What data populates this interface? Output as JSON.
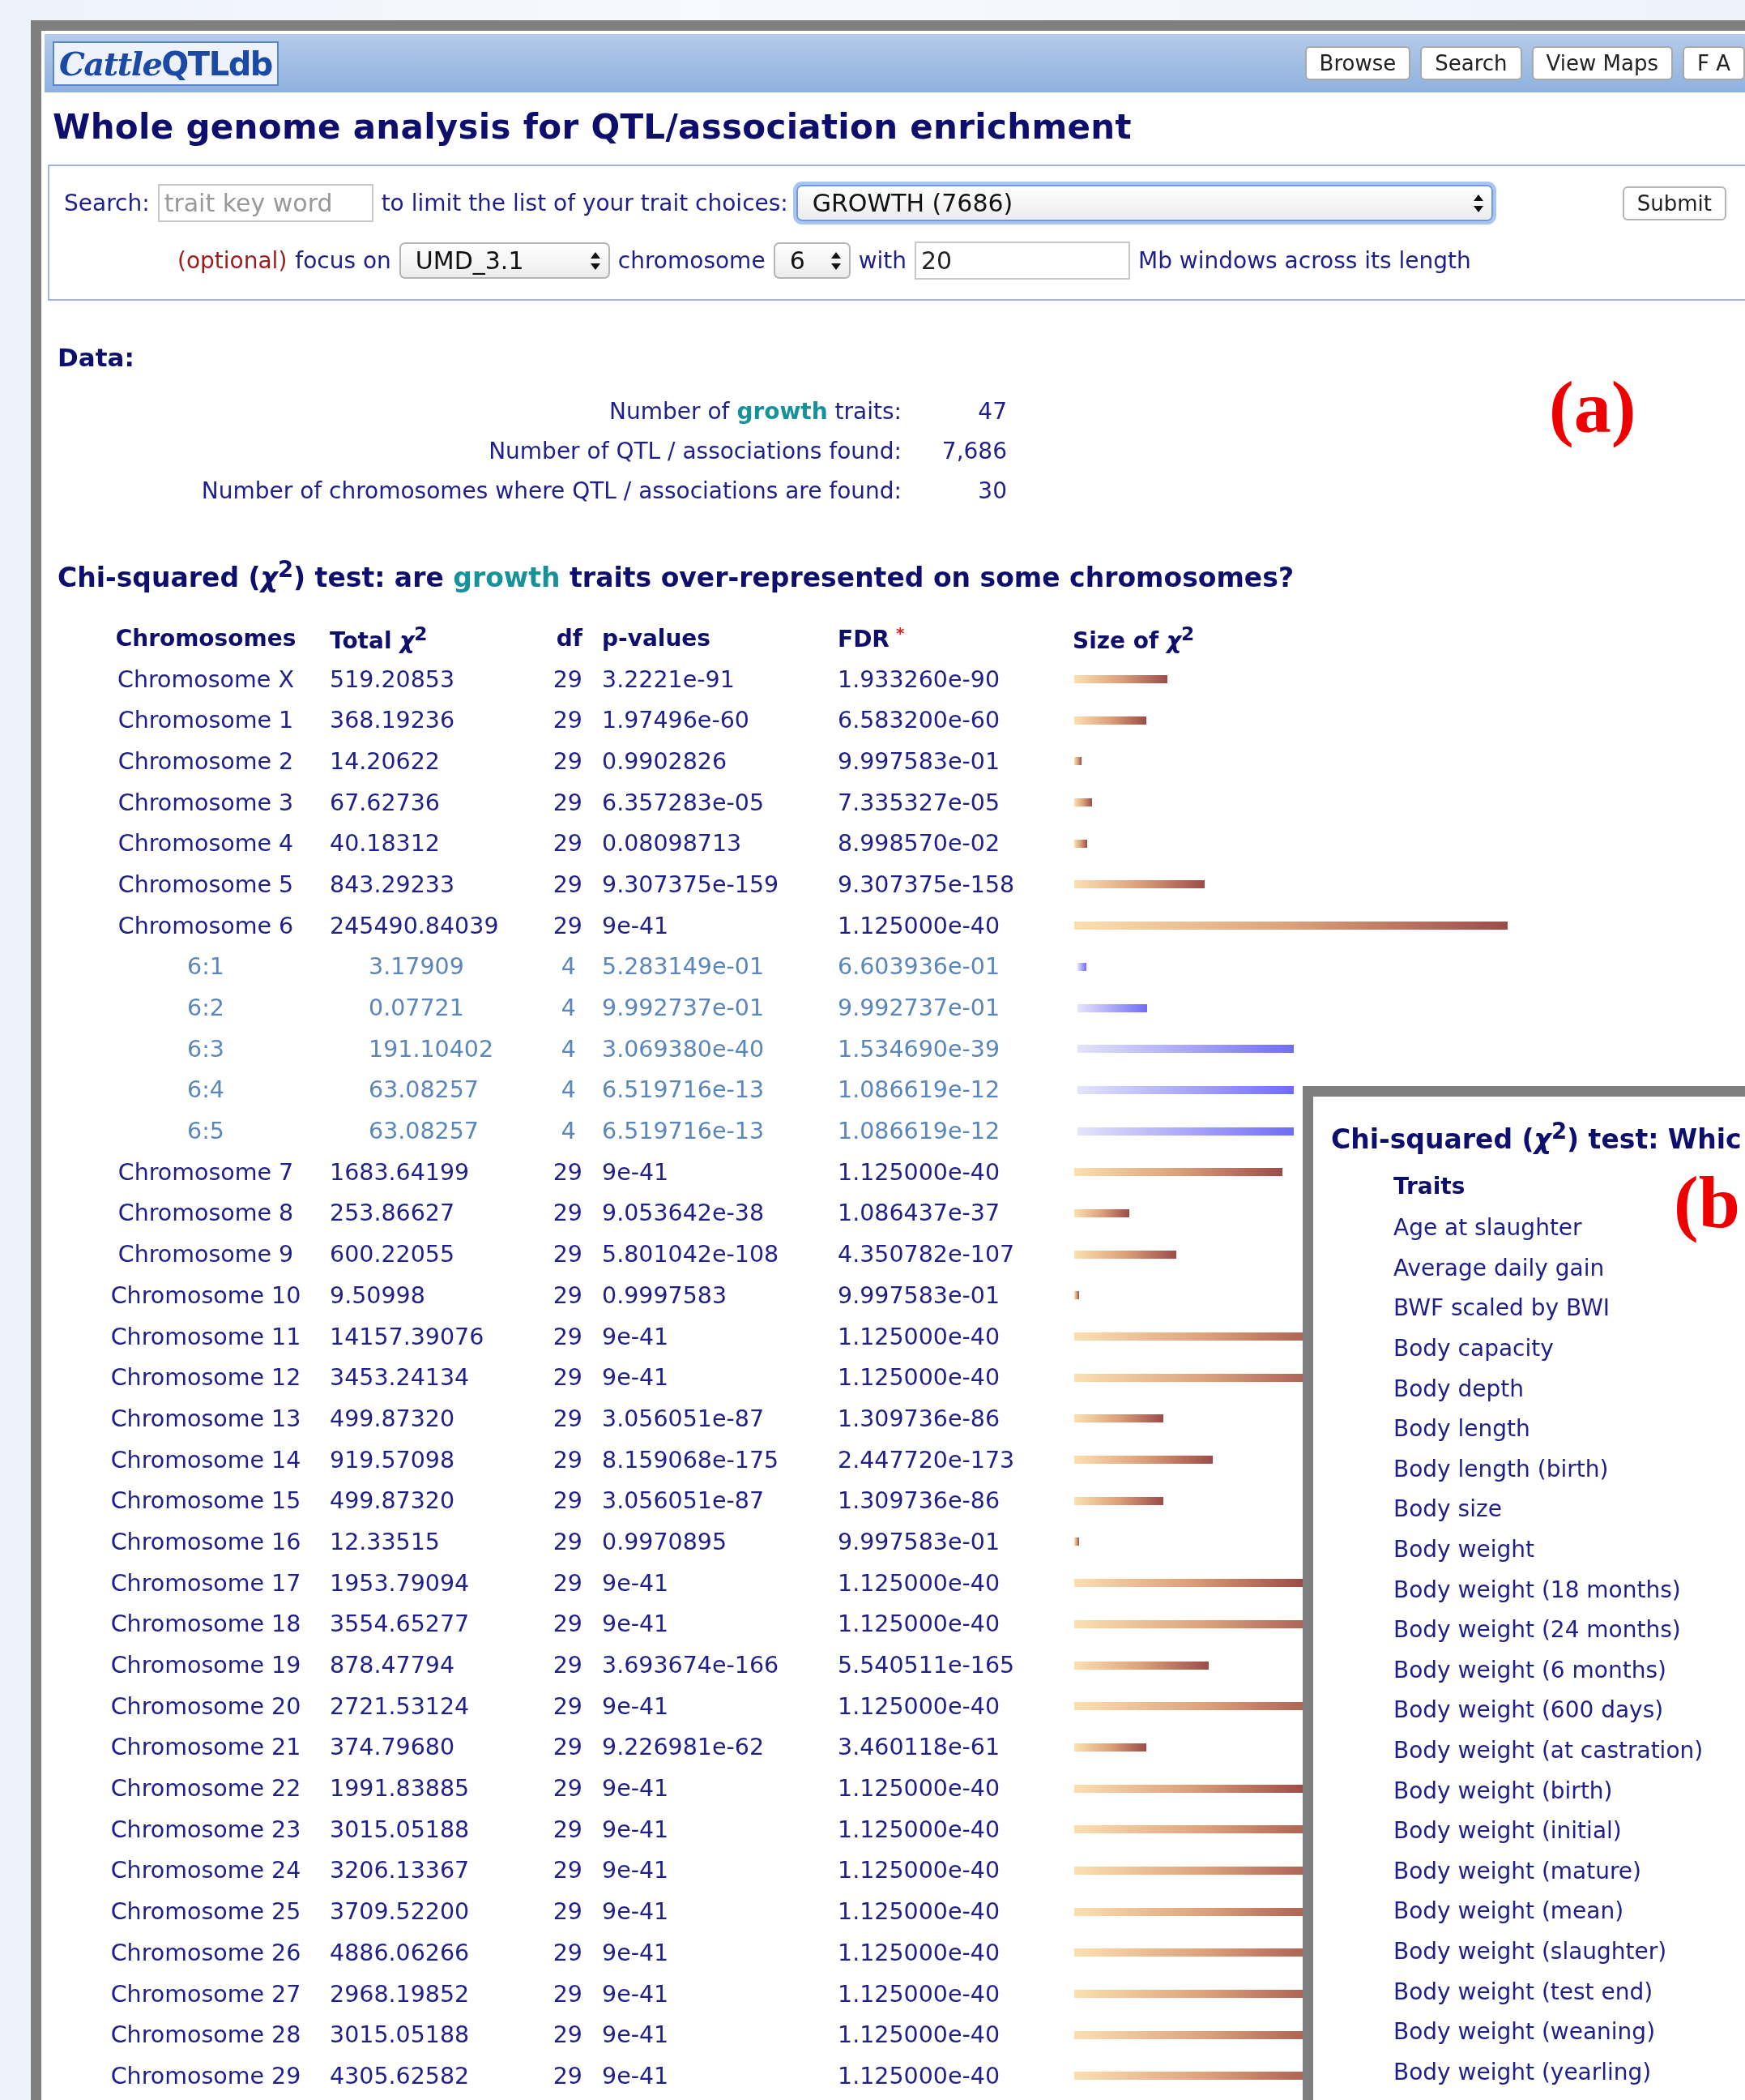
{
  "header": {
    "logo": [
      "Cattle",
      "QTLdb"
    ],
    "nav": [
      "Browse",
      "Search",
      "View Maps",
      "F A"
    ]
  },
  "title": "Whole genome analysis for QTL/association enrichment",
  "search_form": {
    "search_label": "Search:",
    "keyword_field": {
      "placeholder": "trait key word"
    },
    "limit_text": "to limit the list of your trait choices:",
    "trait_select": {
      "value": "GROWTH (7686)",
      "focused": true
    },
    "submit": "Submit",
    "optional_label": "(optional)",
    "focus_text": "focus on",
    "assembly_select": {
      "value": "UMD_3.1",
      "focused": false
    },
    "chromosome_text": "chromosome",
    "chromosome_select": {
      "value": "6",
      "focused": false
    },
    "with_text": "with",
    "window_field": {
      "value": "20"
    },
    "windows_text": "Mb windows across its length"
  },
  "data_heading": "Data:",
  "stats": [
    {
      "label": [
        {
          "text": "Number of "
        },
        {
          "text": "growth",
          "highlight": true
        },
        {
          "text": " traits:"
        }
      ],
      "value": "47"
    },
    {
      "label": [
        {
          "text": "Number of QTL / associations found:"
        }
      ],
      "value": "7,686"
    },
    {
      "label": [
        {
          "text": "Number of chromosomes where QTL / associations are found:"
        }
      ],
      "value": "30"
    }
  ],
  "chi_heading": [
    {
      "text": "Chi-squared (*χ*$^{2}$) test: are "
    },
    {
      "text": "growth",
      "highlight": true
    },
    {
      "text": " traits over-represented on some chromosomes?"
    }
  ],
  "table": {
    "columns": [
      {
        "label": "Chromosomes"
      },
      {
        "label": "Total *χ*$^{2}$"
      },
      {
        "label": "df"
      },
      {
        "label": "p-values"
      },
      {
        "label": "FDR",
        "note": "*"
      },
      {
        "label": "Size of *χ*$^{2}$"
      }
    ],
    "rows": [
      {
        "kind": "chromosome",
        "name": "Chromosome X",
        "total": "519.20853",
        "df": "29",
        "p": "3.2221e-91",
        "fdr": "1.933260e-90"
      },
      {
        "kind": "chromosome",
        "name": "Chromosome 1",
        "total": "368.19236",
        "df": "29",
        "p": "1.97496e-60",
        "fdr": "6.583200e-60"
      },
      {
        "kind": "chromosome",
        "name": "Chromosome 2",
        "total": "14.20622",
        "df": "29",
        "p": "0.9902826",
        "fdr": "9.997583e-01"
      },
      {
        "kind": "chromosome",
        "name": "Chromosome 3",
        "total": "67.62736",
        "df": "29",
        "p": "6.357283e-05",
        "fdr": "7.335327e-05"
      },
      {
        "kind": "chromosome",
        "name": "Chromosome 4",
        "total": "40.18312",
        "df": "29",
        "p": "0.08098713",
        "fdr": "8.998570e-02"
      },
      {
        "kind": "chromosome",
        "name": "Chromosome 5",
        "total": "843.29233",
        "df": "29",
        "p": "9.307375e-159",
        "fdr": "9.307375e-158"
      },
      {
        "kind": "chromosome",
        "name": "Chromosome 6",
        "total": "245490.84039",
        "df": "29",
        "p": "9e-41",
        "fdr": "1.125000e-40"
      },
      {
        "kind": "window",
        "name": "6:1",
        "total": "3.17909",
        "df": "4",
        "p": "5.283149e-01",
        "fdr": "6.603936e-01"
      },
      {
        "kind": "window",
        "name": "6:2",
        "total": "0.07721",
        "df": "4",
        "p": "9.992737e-01",
        "fdr": "9.992737e-01"
      },
      {
        "kind": "window",
        "name": "6:3",
        "total": "191.10402",
        "df": "4",
        "p": "3.069380e-40",
        "fdr": "1.534690e-39"
      },
      {
        "kind": "window",
        "name": "6:4",
        "total": "63.08257",
        "df": "4",
        "p": "6.519716e-13",
        "fdr": "1.086619e-12"
      },
      {
        "kind": "window",
        "name": "6:5",
        "total": "63.08257",
        "df": "4",
        "p": "6.519716e-13",
        "fdr": "1.086619e-12"
      },
      {
        "kind": "chromosome",
        "name": "Chromosome 7",
        "total": "1683.64199",
        "df": "29",
        "p": "9e-41",
        "fdr": "1.125000e-40"
      },
      {
        "kind": "chromosome",
        "name": "Chromosome 8",
        "total": "253.86627",
        "df": "29",
        "p": "9.053642e-38",
        "fdr": "1.086437e-37"
      },
      {
        "kind": "chromosome",
        "name": "Chromosome 9",
        "total": "600.22055",
        "df": "29",
        "p": "5.801042e-108",
        "fdr": "4.350782e-107"
      },
      {
        "kind": "chromosome",
        "name": "Chromosome 10",
        "total": "9.50998",
        "df": "29",
        "p": "0.9997583",
        "fdr": "9.997583e-01"
      },
      {
        "kind": "chromosome",
        "name": "Chromosome 11",
        "total": "14157.39076",
        "df": "29",
        "p": "9e-41",
        "fdr": "1.125000e-40"
      },
      {
        "kind": "chromosome",
        "name": "Chromosome 12",
        "total": "3453.24134",
        "df": "29",
        "p": "9e-41",
        "fdr": "1.125000e-40"
      },
      {
        "kind": "chromosome",
        "name": "Chromosome 13",
        "total": "499.87320",
        "df": "29",
        "p": "3.056051e-87",
        "fdr": "1.309736e-86"
      },
      {
        "kind": "chromosome",
        "name": "Chromosome 14",
        "total": "919.57098",
        "df": "29",
        "p": "8.159068e-175",
        "fdr": "2.447720e-173"
      },
      {
        "kind": "chromosome",
        "name": "Chromosome 15",
        "total": "499.87320",
        "df": "29",
        "p": "3.056051e-87",
        "fdr": "1.309736e-86"
      },
      {
        "kind": "chromosome",
        "name": "Chromosome 16",
        "total": "12.33515",
        "df": "29",
        "p": "0.9970895",
        "fdr": "9.997583e-01"
      },
      {
        "kind": "chromosome",
        "name": "Chromosome 17",
        "total": "1953.79094",
        "df": "29",
        "p": "9e-41",
        "fdr": "1.125000e-40"
      },
      {
        "kind": "chromosome",
        "name": "Chromosome 18",
        "total": "3554.65277",
        "df": "29",
        "p": "9e-41",
        "fdr": "1.125000e-40"
      },
      {
        "kind": "chromosome",
        "name": "Chromosome 19",
        "total": "878.47794",
        "df": "29",
        "p": "3.693674e-166",
        "fdr": "5.540511e-165"
      },
      {
        "kind": "chromosome",
        "name": "Chromosome 20",
        "total": "2721.53124",
        "df": "29",
        "p": "9e-41",
        "fdr": "1.125000e-40"
      },
      {
        "kind": "chromosome",
        "name": "Chromosome 21",
        "total": "374.79680",
        "df": "29",
        "p": "9.226981e-62",
        "fdr": "3.460118e-61"
      },
      {
        "kind": "chromosome",
        "name": "Chromosome 22",
        "total": "1991.83885",
        "df": "29",
        "p": "9e-41",
        "fdr": "1.125000e-40"
      },
      {
        "kind": "chromosome",
        "name": "Chromosome 23",
        "total": "3015.05188",
        "df": "29",
        "p": "9e-41",
        "fdr": "1.125000e-40"
      },
      {
        "kind": "chromosome",
        "name": "Chromosome 24",
        "total": "3206.13367",
        "df": "29",
        "p": "9e-41",
        "fdr": "1.125000e-40"
      },
      {
        "kind": "chromosome",
        "name": "Chromosome 25",
        "total": "3709.52200",
        "df": "29",
        "p": "9e-41",
        "fdr": "1.125000e-40"
      },
      {
        "kind": "chromosome",
        "name": "Chromosome 26",
        "total": "4886.06266",
        "df": "29",
        "p": "9e-41",
        "fdr": "1.125000e-40"
      },
      {
        "kind": "chromosome",
        "name": "Chromosome 27",
        "total": "2968.19852",
        "df": "29",
        "p": "9e-41",
        "fdr": "1.125000e-40"
      },
      {
        "kind": "chromosome",
        "name": "Chromosome 28",
        "total": "3015.05188",
        "df": "29",
        "p": "9e-41",
        "fdr": "1.125000e-40"
      },
      {
        "kind": "chromosome",
        "name": "Chromosome 29",
        "total": "4305.62582",
        "df": "29",
        "p": "9e-41",
        "fdr": "1.125000e-40"
      }
    ]
  },
  "trait_panel": {
    "title": "Chi-squared (*χ*$^{2}$) test: Whic",
    "column": "Traits",
    "traits": [
      "Age at slaughter",
      "Average daily gain",
      "BWF scaled by BWI",
      "Body capacity",
      "Body depth",
      "Body length",
      "Body length (birth)",
      "Body size",
      "Body weight",
      "Body weight (18 months)",
      "Body weight (24 months)",
      "Body weight (6 months)",
      "Body weight (600 days)",
      "Body weight (at castration)",
      "Body weight (birth)",
      "Body weight (initial)",
      "Body weight (mature)",
      "Body weight (mean)",
      "Body weight (slaughter)",
      "Body weight (test end)",
      "Body weight (weaning)",
      "Body weight (yearling)"
    ]
  },
  "figure_labels": [
    "(a)",
    "(b"
  ]
}
